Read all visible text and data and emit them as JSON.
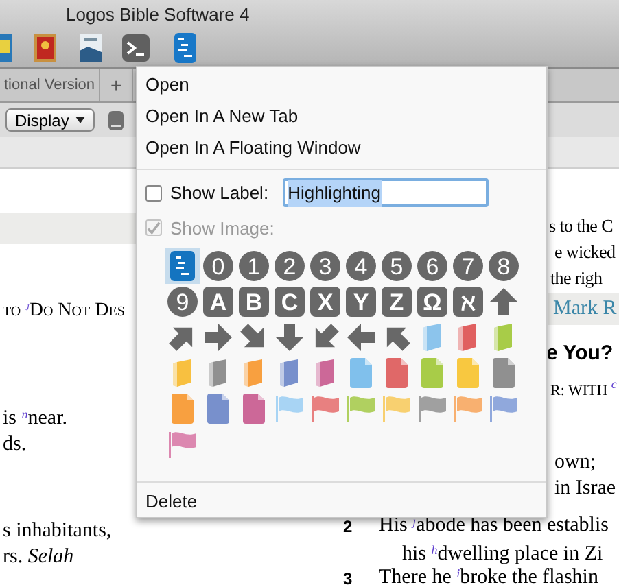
{
  "window": {
    "title": "Logos Bible Software 4"
  },
  "tabs": [
    {
      "label": "tional Version"
    }
  ],
  "new_tab_button": "+",
  "display_button": {
    "label": "Display"
  },
  "left_pane": {
    "lines": [
      {
        "kind": "band"
      },
      {
        "kind": "smallcaps",
        "text": "to $^{j}$Do Not Des"
      },
      {
        "kind": "text",
        "text": "is $^{n}$near."
      },
      {
        "kind": "text",
        "text": "ds."
      },
      {
        "kind": "text",
        "text": "s inhabitants,"
      },
      {
        "kind": "text",
        "text": "rs.  *Selah*"
      }
    ]
  },
  "right_pane": {
    "lines": [
      {
        "kind": "text",
        "text": "s to the C"
      },
      {
        "kind": "text",
        "text": "e wicked"
      },
      {
        "kind": "text",
        "text": "the righ"
      },
      {
        "kind": "band",
        "text": "Mark R"
      },
      {
        "kind": "heading",
        "text": "e You?"
      },
      {
        "kind": "smallcaps",
        "text": "R: WITH $^{c}$"
      },
      {
        "kind": "text",
        "text": "own;"
      },
      {
        "kind": "text",
        "text": "in Israe"
      },
      {
        "kind": "verse",
        "number": "2",
        "text": "His $^{j}$abode has been establis"
      },
      {
        "kind": "indent",
        "text": "his $^{h}$dwelling place in Zi"
      },
      {
        "kind": "verse",
        "number": "3",
        "text": "There he $^{i}$broke the flashin"
      }
    ]
  },
  "popup": {
    "menu_items": [
      "Open",
      "Open In A New Tab",
      "Open In A Floating Window"
    ],
    "show_label": {
      "label": "Show Label:",
      "checked": false,
      "value": "Highlighting"
    },
    "show_image": {
      "label": "Show Image:",
      "checked": true,
      "disabled": true
    },
    "images": [
      {
        "kind": "app",
        "selected": true
      },
      {
        "kind": "digit",
        "text": "0",
        "selected": false
      },
      {
        "kind": "digit",
        "text": "1",
        "selected": false
      },
      {
        "kind": "digit",
        "text": "2",
        "selected": false
      },
      {
        "kind": "digit",
        "text": "3",
        "selected": false
      },
      {
        "kind": "digit",
        "text": "4",
        "selected": false
      },
      {
        "kind": "digit",
        "text": "5",
        "selected": false
      },
      {
        "kind": "digit",
        "text": "6",
        "selected": false
      },
      {
        "kind": "digit",
        "text": "7",
        "selected": false
      },
      {
        "kind": "digit",
        "text": "8",
        "selected": false
      },
      {
        "kind": "digit",
        "text": "9",
        "selected": false
      },
      {
        "kind": "letter",
        "text": "A",
        "selected": false
      },
      {
        "kind": "letter",
        "text": "B",
        "selected": false
      },
      {
        "kind": "letter",
        "text": "C",
        "selected": false
      },
      {
        "kind": "letter",
        "text": "X",
        "selected": false
      },
      {
        "kind": "letter",
        "text": "Y",
        "selected": false
      },
      {
        "kind": "letter",
        "text": "Z",
        "selected": false
      },
      {
        "kind": "letter",
        "text": "Ω",
        "selected": false
      },
      {
        "kind": "letter",
        "text": "ℵ",
        "selected": false
      },
      {
        "kind": "uparrow",
        "selected": false
      },
      {
        "kind": "uprightarrow",
        "selected": false
      },
      {
        "kind": "rightarrow",
        "selected": false
      },
      {
        "kind": "downrightarrow",
        "selected": false
      },
      {
        "kind": "downarrow",
        "selected": false
      },
      {
        "kind": "downleftarrow",
        "selected": false
      },
      {
        "kind": "leftarrow",
        "selected": false
      },
      {
        "kind": "upleftarrow",
        "selected": false
      },
      {
        "kind": "book",
        "color": "#8cc4ec",
        "selected": false
      },
      {
        "kind": "book",
        "color": "#e06060",
        "selected": false
      },
      {
        "kind": "book",
        "color": "#a8cc48",
        "selected": false
      },
      {
        "kind": "book",
        "color": "#f8c040",
        "selected": false
      },
      {
        "kind": "book",
        "color": "#909090",
        "selected": false
      },
      {
        "kind": "book",
        "color": "#f8a040",
        "selected": false
      },
      {
        "kind": "book",
        "color": "#7890cc",
        "selected": false
      },
      {
        "kind": "book",
        "color": "#cc6898",
        "selected": false
      },
      {
        "kind": "doc",
        "color": "#80c0ec",
        "selected": false
      },
      {
        "kind": "doc",
        "color": "#e06868",
        "selected": false
      },
      {
        "kind": "doc",
        "color": "#a8cc48",
        "selected": false
      },
      {
        "kind": "doc",
        "color": "#f8c840",
        "selected": false
      },
      {
        "kind": "doc",
        "color": "#909090",
        "selected": false
      },
      {
        "kind": "doc",
        "color": "#f8a040",
        "selected": false
      },
      {
        "kind": "doc",
        "color": "#7890cc",
        "selected": false
      },
      {
        "kind": "doc",
        "color": "#cc6898",
        "selected": false
      },
      {
        "kind": "flag",
        "color": "#a8d4f4",
        "selected": false
      },
      {
        "kind": "flag",
        "color": "#e88080",
        "selected": false
      },
      {
        "kind": "flag",
        "color": "#b0d060",
        "selected": false
      },
      {
        "kind": "flag",
        "color": "#f8d070",
        "selected": false
      },
      {
        "kind": "flag",
        "color": "#a0a0a0",
        "selected": false
      },
      {
        "kind": "flag",
        "color": "#f8b070",
        "selected": false
      },
      {
        "kind": "flag",
        "color": "#90a8dc",
        "selected": false
      },
      {
        "kind": "flag",
        "color": "#dc88b0",
        "selected": false
      }
    ],
    "footer_items": [
      "Delete"
    ]
  }
}
